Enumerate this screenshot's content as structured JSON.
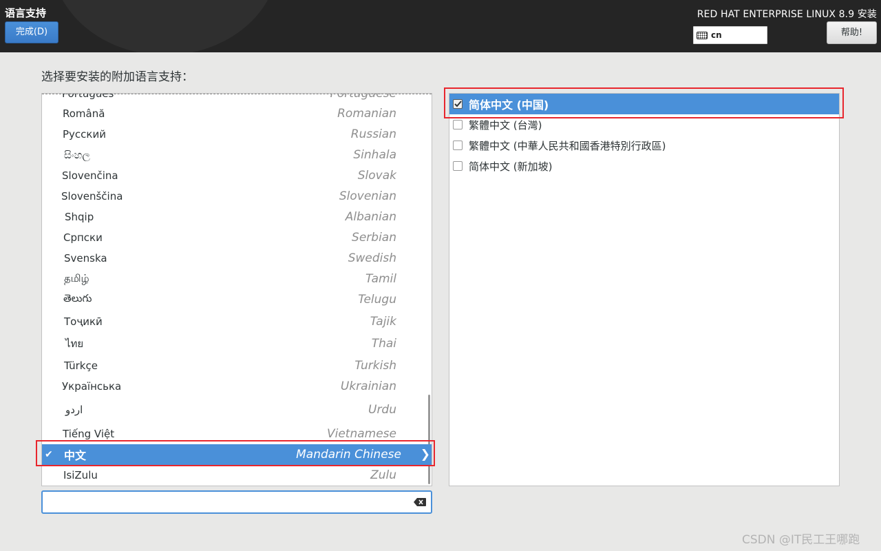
{
  "header": {
    "spoke_title": "语言支持",
    "done_button_label": "完成(D)",
    "product_title": "RED HAT ENTERPRISE LINUX 8.9 安装",
    "keyboard_layout": "cn",
    "help_button_label": "帮助!"
  },
  "prompt": "选择要安装的附加语言支持：",
  "languages": [
    {
      "native": "Português",
      "english": "Portuguese"
    },
    {
      "native": "Română",
      "english": "Romanian"
    },
    {
      "native": "Русский",
      "english": "Russian"
    },
    {
      "native": "සිංහල",
      "english": "Sinhala"
    },
    {
      "native": "Slovenčina",
      "english": "Slovak"
    },
    {
      "native": "Slovenščina",
      "english": "Slovenian"
    },
    {
      "native": "Shqip",
      "english": "Albanian"
    },
    {
      "native": "Српски",
      "english": "Serbian"
    },
    {
      "native": "Svenska",
      "english": "Swedish"
    },
    {
      "native": "தமிழ்",
      "english": "Tamil"
    },
    {
      "native": "తెలుగు",
      "english": "Telugu"
    },
    {
      "native": "Тоҷикӣ",
      "english": "Tajik"
    },
    {
      "native": "ไทย",
      "english": "Thai"
    },
    {
      "native": "Türkçe",
      "english": "Turkish"
    },
    {
      "native": "Українська",
      "english": "Ukrainian"
    },
    {
      "native": "اردو",
      "english": "Urdu"
    },
    {
      "native": "Tiếng Việt",
      "english": "Vietnamese"
    },
    {
      "native": "中文",
      "english": "Mandarin Chinese",
      "selected": true,
      "checked": true
    },
    {
      "native": "IsiZulu",
      "english": "Zulu"
    }
  ],
  "search": {
    "value": "",
    "placeholder": ""
  },
  "locales": [
    {
      "label": "简体中文 (中国)",
      "checked": true,
      "selected": true
    },
    {
      "label": "繁體中文 (台灣)",
      "checked": false
    },
    {
      "label": "繁體中文 (中華人民共和國香港特別行政區)",
      "checked": false
    },
    {
      "label": "简体中文 (新加坡)",
      "checked": false
    }
  ],
  "watermark": "CSDN @IT民工王哪跑",
  "colors": {
    "accent": "#4a90d9",
    "header_bg": "#252525",
    "highlight_red": "#e8262d"
  },
  "icons": {
    "keyboard": "keyboard-icon",
    "check": "check-icon",
    "chevron": "chevron-right-icon",
    "clear": "clear-input-icon"
  }
}
